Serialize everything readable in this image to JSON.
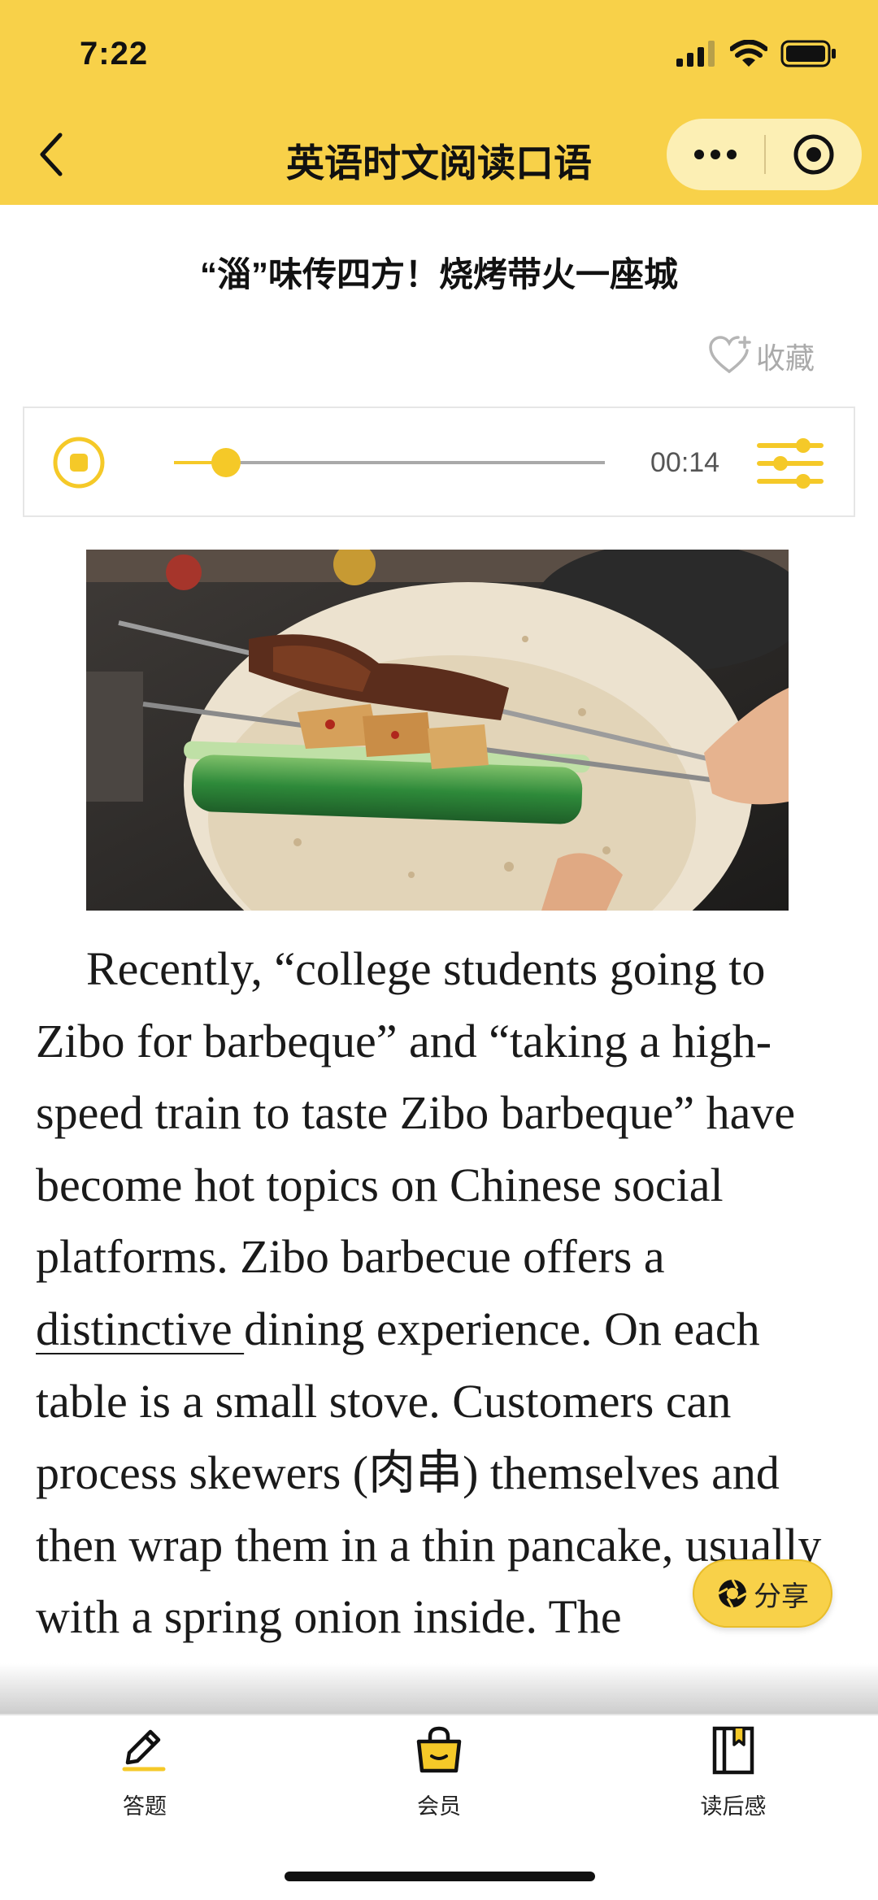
{
  "status_bar": {
    "time": "7:22"
  },
  "nav": {
    "title": "英语时文阅读口语"
  },
  "article": {
    "title": "“淄”味传四方！烧烤带火一座城",
    "favorite_label": "收藏",
    "body_before": "Recently, “college students going to Zibo for barbeque” and “taking a high-speed train to taste Zibo barbeque” have become hot topics on Chinese social platforms. Zibo barbecue offers a ",
    "vocab_word": "distinctive ",
    "body_after": "dining experience. On each table is a small stove. Customers can process skewers (肉串) themselves and then wrap them in a thin pancake, usually with a spring onion inside. The"
  },
  "audio": {
    "time": "00:14",
    "progress": 0.12
  },
  "share": {
    "label": "分享"
  },
  "tabs": [
    {
      "label": "答题",
      "icon": "pencil-icon"
    },
    {
      "label": "会员",
      "icon": "shopping-bag-icon"
    },
    {
      "label": "读后感",
      "icon": "bookmark-book-icon"
    }
  ],
  "colors": {
    "brand_yellow": "#f8d149",
    "accent_yellow": "#f5c928",
    "capsule": "#fcefb4"
  }
}
